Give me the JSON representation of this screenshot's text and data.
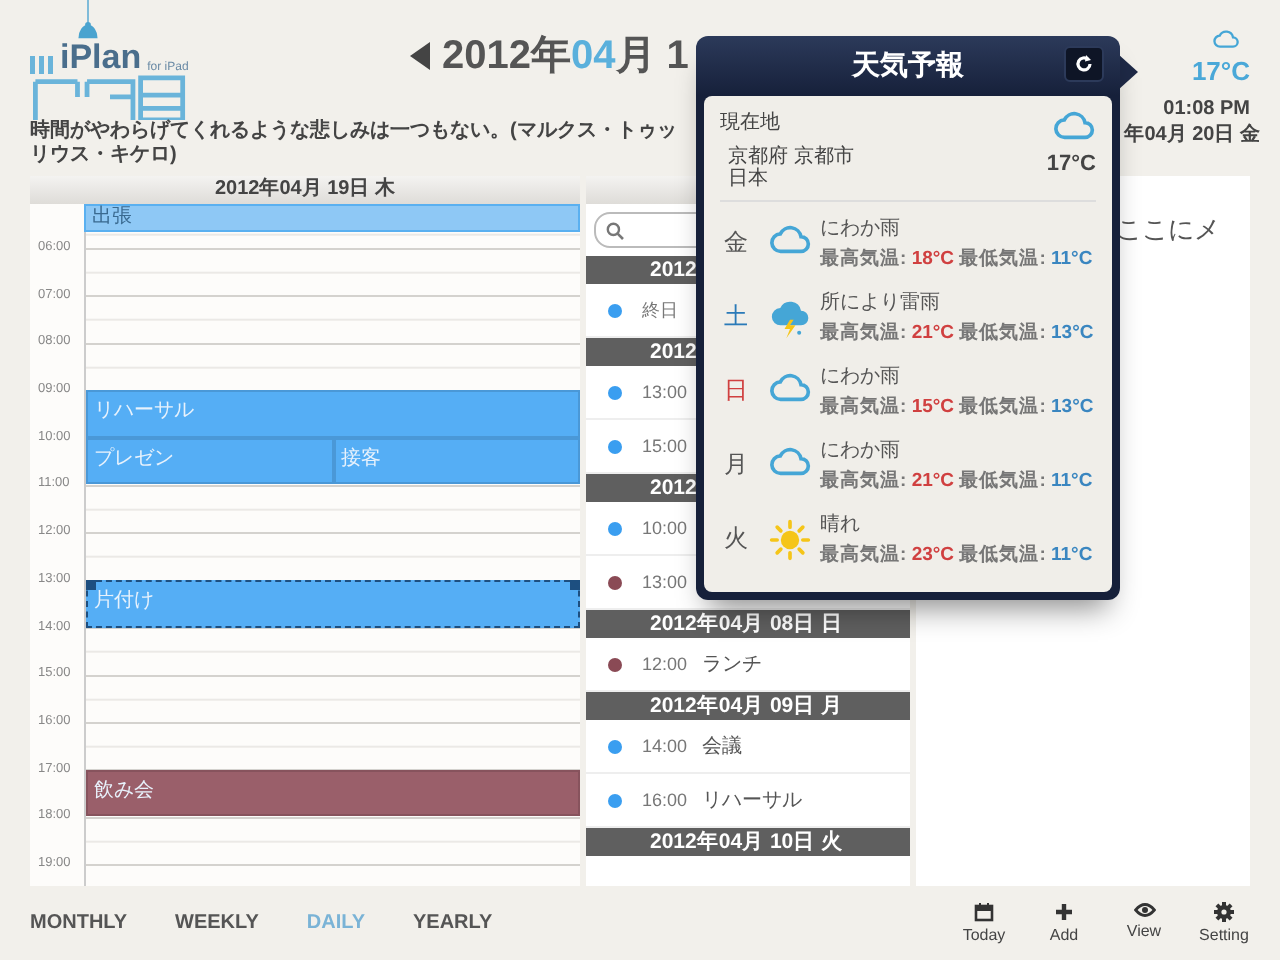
{
  "header": {
    "logo": {
      "name": "iPlan",
      "subtitle": "for iPad"
    },
    "title": {
      "year": "2012年",
      "month": "04",
      "rest": "月 1"
    },
    "quote": "時間がやわらげてくれるような悲しみは一つもない。(マルクス・トゥッリウス・キケロ)",
    "weather": {
      "kind": "rain",
      "temp": "17°C"
    },
    "time": "01:08 PM",
    "date": "年04月 20日 金"
  },
  "day": {
    "heading": "2012年04月 19日 木",
    "all_day": [
      {
        "title": "出張"
      }
    ],
    "hours": [
      {
        "label": "06:00"
      },
      {
        "label": "07:00"
      },
      {
        "label": "08:00"
      },
      {
        "label": "09:00",
        "events": [
          {
            "title": "リハーサル",
            "color": "#55aef5",
            "selected": false
          }
        ]
      },
      {
        "label": "10:00",
        "events": [
          {
            "title": "プレゼン",
            "color": "#55aef5",
            "selected": false
          },
          {
            "title": "接客",
            "color": "#55aef5",
            "selected": false
          }
        ]
      },
      {
        "label": "11:00"
      },
      {
        "label": "12:00"
      },
      {
        "label": "13:00",
        "events": [
          {
            "title": "片付け",
            "color": "#55aef5",
            "selected": true
          }
        ]
      },
      {
        "label": "14:00"
      },
      {
        "label": "15:00"
      },
      {
        "label": "16:00"
      },
      {
        "label": "17:00",
        "events": [
          {
            "title": "飲み会",
            "color": "#9a5f6a",
            "selected": false
          }
        ]
      },
      {
        "label": "18:00"
      },
      {
        "label": "19:00"
      }
    ]
  },
  "agenda": [
    {
      "heading": "2012",
      "events": [
        {
          "time": "終日",
          "color": "#3a9ef0"
        }
      ]
    },
    {
      "heading": "2012",
      "events": [
        {
          "time": "13:00",
          "color": "#3a9ef0"
        },
        {
          "time": "15:00",
          "color": "#3a9ef0"
        }
      ]
    },
    {
      "heading": "2012",
      "events": [
        {
          "time": "10:00",
          "color": "#3a9ef0"
        },
        {
          "time": "13:00",
          "color": "#8a4a55"
        }
      ]
    },
    {
      "heading": "2012年04月 08日 日",
      "events": [
        {
          "time": "12:00",
          "title": "ランチ",
          "color": "#8a4a55"
        }
      ]
    },
    {
      "heading": "2012年04月 09日 月",
      "events": [
        {
          "time": "14:00",
          "title": "会議",
          "color": "#3a9ef0"
        },
        {
          "time": "16:00",
          "title": "リハーサル",
          "color": "#3a9ef0"
        }
      ]
    },
    {
      "heading": "2012年04月 10日 火"
    }
  ],
  "notes": {
    "text": "ここにメ"
  },
  "weather_popover": {
    "title": "天気予報",
    "current": {
      "label": "現在地",
      "place": "京都府 京都市",
      "country": "日本",
      "kind": "rain",
      "temp": "17°C"
    },
    "forecast": [
      {
        "day": "金",
        "color": "#555555",
        "kind": "rain",
        "condition": "にわか雨",
        "high_label": "最高気温:",
        "high": "18°C",
        "low_label": "最低気温:",
        "low": "11°C"
      },
      {
        "day": "土",
        "color": "#2a7ab8",
        "kind": "thunder",
        "condition": "所により雷雨",
        "high_label": "最高気温:",
        "high": "21°C",
        "low_label": "最低気温:",
        "low": "13°C"
      },
      {
        "day": "日",
        "color": "#d04040",
        "kind": "rain",
        "condition": "にわか雨",
        "high_label": "最高気温:",
        "high": "15°C",
        "low_label": "最低気温:",
        "low": "13°C"
      },
      {
        "day": "月",
        "color": "#555555",
        "kind": "rain",
        "condition": "にわか雨",
        "high_label": "最高気温:",
        "high": "21°C",
        "low_label": "最低気温:",
        "low": "11°C"
      },
      {
        "day": "火",
        "color": "#555555",
        "kind": "sun",
        "condition": "晴れ",
        "high_label": "最高気温:",
        "high": "23°C",
        "low_label": "最低気温:",
        "low": "11°C"
      }
    ]
  },
  "view_tabs": [
    {
      "label": "MONTHLY",
      "selected": false
    },
    {
      "label": "WEEKLY",
      "selected": false
    },
    {
      "label": "DAILY",
      "selected": true
    },
    {
      "label": "YEARLY",
      "selected": false
    }
  ],
  "toolbar": [
    {
      "kind": "today",
      "label": "Today"
    },
    {
      "kind": "add",
      "label": "Add"
    },
    {
      "kind": "view",
      "label": "View"
    },
    {
      "kind": "setting",
      "label": "Setting"
    }
  ]
}
